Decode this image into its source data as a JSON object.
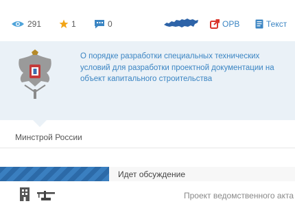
{
  "stats": {
    "views": "291",
    "favorites": "1",
    "comments": "0"
  },
  "links": {
    "orv_label": "ОРВ",
    "text_label": "Текст"
  },
  "project": {
    "title": "О порядке разработки специальных технических условий для разработки проектной документации на объект капитального строительства",
    "organization": "Минстрой России",
    "status": "Идет обсуждение",
    "progress_fraction": 0.37,
    "doc_type": "Проект ведомственного акта"
  },
  "icons": {
    "views": "eye-icon",
    "favorites": "star-icon",
    "comments": "comment-icon",
    "map": "russia-map-icon",
    "orv": "external-link-icon",
    "text": "document-icon",
    "emblem": "ministry-emblem-icon",
    "building": "building-icon",
    "construction": "crane-icon"
  },
  "colors": {
    "accent": "#3b85c3",
    "star": "#f2a516",
    "orv_red": "#d9342b",
    "progress": "#2c6aa8",
    "card_bg": "#eaf1f7"
  }
}
